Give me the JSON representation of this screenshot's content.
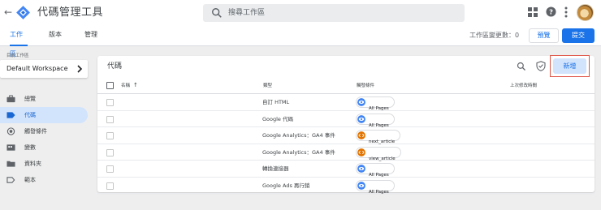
{
  "app": {
    "title": "代碼管理工具",
    "search_placeholder": "搜尋工作區"
  },
  "tabs": [
    {
      "label": "工作區",
      "active": true
    },
    {
      "label": "版本",
      "active": false
    },
    {
      "label": "管理",
      "active": false
    }
  ],
  "toolbar": {
    "changes_label": "工作區變更數：0",
    "preview_label": "預覽",
    "submit_label": "提交"
  },
  "sidebar": {
    "workspace_label": "目前工作區",
    "workspace_name": "Default Workspace",
    "items": [
      {
        "label": "總覽",
        "icon": "briefcase-icon",
        "active": false
      },
      {
        "label": "代碼",
        "icon": "tag-icon",
        "active": true
      },
      {
        "label": "觸發條件",
        "icon": "trigger-icon",
        "active": false
      },
      {
        "label": "變數",
        "icon": "variables-icon",
        "active": false
      },
      {
        "label": "資料夾",
        "icon": "folder-icon",
        "active": false
      },
      {
        "label": "範本",
        "icon": "template-icon",
        "active": false
      }
    ]
  },
  "main": {
    "title": "代碼",
    "new_button_label": "新增",
    "columns": {
      "name": "名稱",
      "type": "類型",
      "trigger": "觸發條件",
      "last_edited": "上次修改時間"
    },
    "rows": [
      {
        "type": "自訂 HTML",
        "trigger": "All Pages",
        "trigger_icon": "pageview-icon"
      },
      {
        "type": "Google 代碼",
        "trigger": "All Pages",
        "trigger_icon": "pageview-icon"
      },
      {
        "type": "Google Analytics：GA4 事件",
        "trigger": "next_article",
        "trigger_icon": "custom-event-icon"
      },
      {
        "type": "Google Analytics：GA4 事件",
        "trigger": "view_article",
        "trigger_icon": "custom-event-icon"
      },
      {
        "type": "轉換連接器",
        "trigger": "All Pages",
        "trigger_icon": "pageview-icon"
      },
      {
        "type": "Google Ads 再行銷",
        "trigger": "All Pages",
        "trigger_icon": "pageview-icon"
      }
    ]
  },
  "colors": {
    "accent": "#1a73e8",
    "active_nav_bg": "#d2e3fc",
    "pageview_icon": "#4285f4",
    "custom_event_icon": "#e37400",
    "highlight_outline": "#e0574a"
  }
}
